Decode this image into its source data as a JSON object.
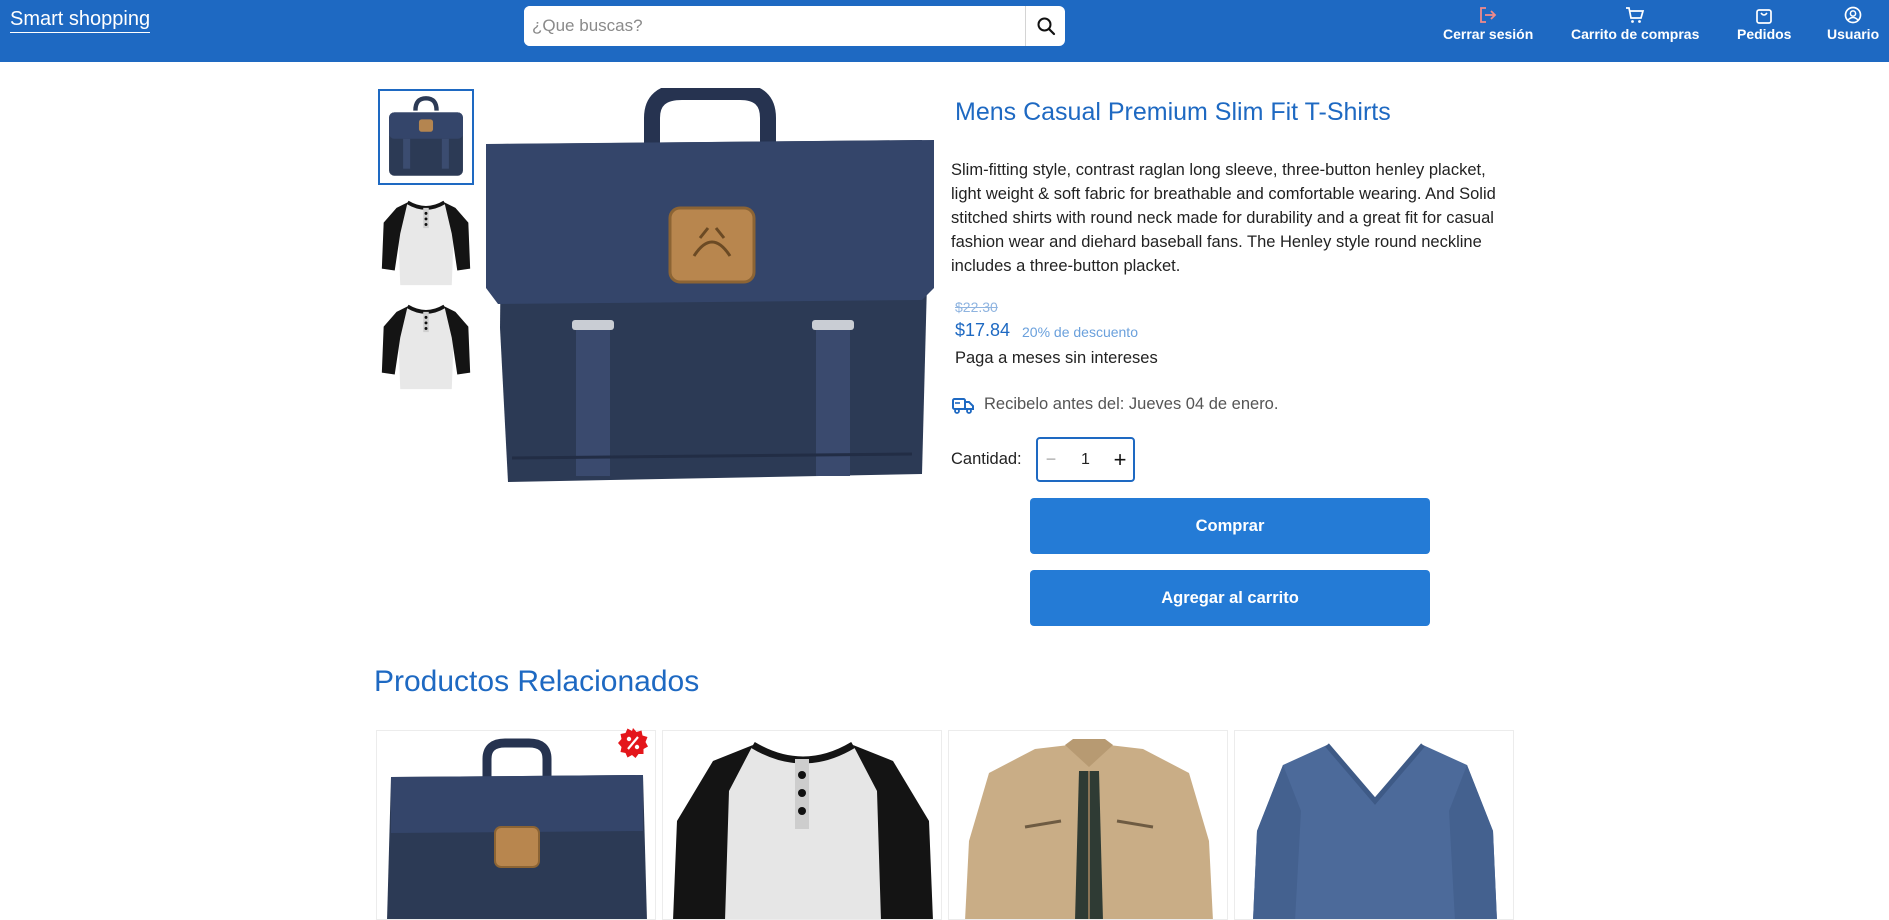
{
  "header": {
    "brand": "Smart shopping",
    "search_placeholder": "¿Que buscas?",
    "nav": {
      "logout": "Cerrar sesión",
      "cart": "Carrito de compras",
      "orders": "Pedidos",
      "user": "Usuario"
    }
  },
  "product": {
    "title": "Mens Casual Premium Slim Fit T-Shirts",
    "description": "Slim-fitting style, contrast raglan long sleeve, three-button henley placket, light weight & soft fabric for breathable and comfortable wearing. And Solid stitched shirts with round neck made for durability and a great fit for casual fashion wear and diehard baseball fans. The Henley style round neckline includes a three-button placket.",
    "old_price": "$22.30",
    "price": "$17.84",
    "discount": "20% de descuento",
    "installments": "Paga a meses sin intereses",
    "delivery": "Recibelo antes del: Jueves 04 de enero.",
    "quantity_label": "Cantidad:",
    "quantity": "1",
    "buy_label": "Comprar",
    "add_to_cart_label": "Agregar al carrito"
  },
  "related": {
    "title": "Productos Relacionados"
  },
  "colors": {
    "header": "#1e69c2",
    "button": "#247bd6",
    "bag": "#2c3a55",
    "badge": "#e4161b"
  }
}
